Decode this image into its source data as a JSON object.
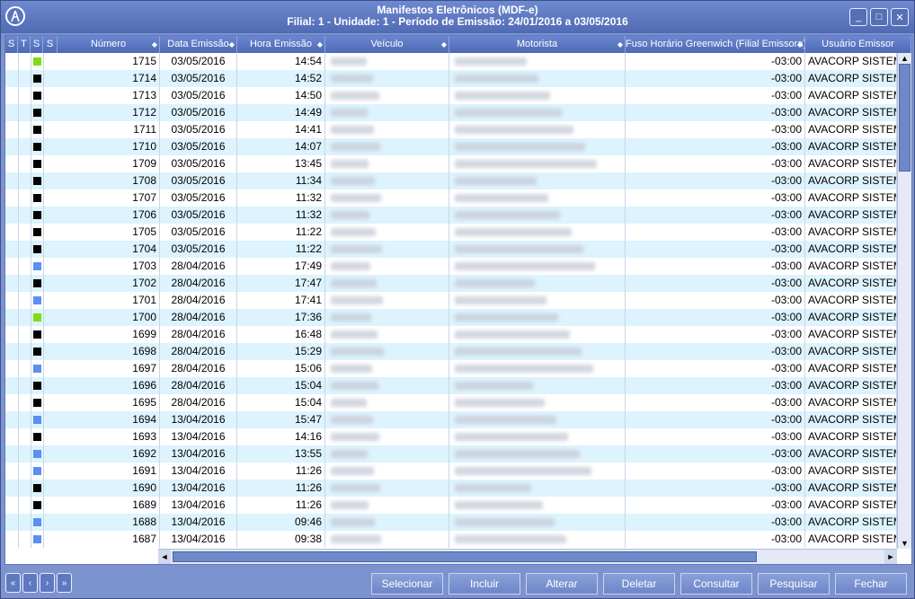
{
  "window": {
    "title_line1": "Manifestos Eletrônicos (MDF-e)",
    "title_line2": "Filial: 1 - Unidade: 1 - Período de Emissão: 24/01/2016 a 03/05/2016",
    "min_label": "_",
    "max_label": "□",
    "close_label": "✕"
  },
  "grid": {
    "headers": {
      "t": "S",
      "s1": "T",
      "s2": "S",
      "s3": "S",
      "numero": "Número",
      "data": "Data Emissão",
      "hora": "Hora Emissão",
      "veiculo": "Veículo",
      "motorista": "Motorista",
      "fuso": "Fuso Horário Greenwich (Filial Emissora)",
      "usuario": "Usuário Emissor"
    },
    "rows": [
      {
        "numero": "1715",
        "data": "03/05/2016",
        "hora": "14:54",
        "fuso": "-03:00",
        "usuario": "AVACORP SISTEMAS",
        "status_color": "#7fdc16"
      },
      {
        "numero": "1714",
        "data": "03/05/2016",
        "hora": "14:52",
        "fuso": "-03:00",
        "usuario": "AVACORP SISTEMAS",
        "status_color": "#000000"
      },
      {
        "numero": "1713",
        "data": "03/05/2016",
        "hora": "14:50",
        "fuso": "-03:00",
        "usuario": "AVACORP SISTEMAS",
        "status_color": "#000000"
      },
      {
        "numero": "1712",
        "data": "03/05/2016",
        "hora": "14:49",
        "fuso": "-03:00",
        "usuario": "AVACORP SISTEMAS",
        "status_color": "#000000"
      },
      {
        "numero": "1711",
        "data": "03/05/2016",
        "hora": "14:41",
        "fuso": "-03:00",
        "usuario": "AVACORP SISTEMAS",
        "status_color": "#000000"
      },
      {
        "numero": "1710",
        "data": "03/05/2016",
        "hora": "14:07",
        "fuso": "-03:00",
        "usuario": "AVACORP SISTEMAS",
        "status_color": "#000000"
      },
      {
        "numero": "1709",
        "data": "03/05/2016",
        "hora": "13:45",
        "fuso": "-03:00",
        "usuario": "AVACORP SISTEMAS",
        "status_color": "#000000"
      },
      {
        "numero": "1708",
        "data": "03/05/2016",
        "hora": "11:34",
        "fuso": "-03:00",
        "usuario": "AVACORP SISTEMAS",
        "status_color": "#000000"
      },
      {
        "numero": "1707",
        "data": "03/05/2016",
        "hora": "11:32",
        "fuso": "-03:00",
        "usuario": "AVACORP SISTEMAS",
        "status_color": "#000000"
      },
      {
        "numero": "1706",
        "data": "03/05/2016",
        "hora": "11:32",
        "fuso": "-03:00",
        "usuario": "AVACORP SISTEMAS",
        "status_color": "#000000"
      },
      {
        "numero": "1705",
        "data": "03/05/2016",
        "hora": "11:22",
        "fuso": "-03:00",
        "usuario": "AVACORP SISTEMAS",
        "status_color": "#000000"
      },
      {
        "numero": "1704",
        "data": "03/05/2016",
        "hora": "11:22",
        "fuso": "-03:00",
        "usuario": "AVACORP SISTEMAS",
        "status_color": "#000000"
      },
      {
        "numero": "1703",
        "data": "28/04/2016",
        "hora": "17:49",
        "fuso": "-03:00",
        "usuario": "AVACORP SISTEMAS",
        "status_color": "#5b8ff0"
      },
      {
        "numero": "1702",
        "data": "28/04/2016",
        "hora": "17:47",
        "fuso": "-03:00",
        "usuario": "AVACORP SISTEMAS",
        "status_color": "#000000"
      },
      {
        "numero": "1701",
        "data": "28/04/2016",
        "hora": "17:41",
        "fuso": "-03:00",
        "usuario": "AVACORP SISTEMAS",
        "status_color": "#5b8ff0"
      },
      {
        "numero": "1700",
        "data": "28/04/2016",
        "hora": "17:36",
        "fuso": "-03:00",
        "usuario": "AVACORP SISTEMAS",
        "status_color": "#7fdc16"
      },
      {
        "numero": "1699",
        "data": "28/04/2016",
        "hora": "16:48",
        "fuso": "-03:00",
        "usuario": "AVACORP SISTEMAS",
        "status_color": "#000000"
      },
      {
        "numero": "1698",
        "data": "28/04/2016",
        "hora": "15:29",
        "fuso": "-03:00",
        "usuario": "AVACORP SISTEMAS",
        "status_color": "#000000"
      },
      {
        "numero": "1697",
        "data": "28/04/2016",
        "hora": "15:06",
        "fuso": "-03:00",
        "usuario": "AVACORP SISTEMAS",
        "status_color": "#5b8ff0"
      },
      {
        "numero": "1696",
        "data": "28/04/2016",
        "hora": "15:04",
        "fuso": "-03:00",
        "usuario": "AVACORP SISTEMAS",
        "status_color": "#000000"
      },
      {
        "numero": "1695",
        "data": "28/04/2016",
        "hora": "15:04",
        "fuso": "-03:00",
        "usuario": "AVACORP SISTEMAS",
        "status_color": "#000000"
      },
      {
        "numero": "1694",
        "data": "13/04/2016",
        "hora": "15:47",
        "fuso": "-03:00",
        "usuario": "AVACORP SISTEMAS",
        "status_color": "#5b8ff0"
      },
      {
        "numero": "1693",
        "data": "13/04/2016",
        "hora": "14:16",
        "fuso": "-03:00",
        "usuario": "AVACORP SISTEMAS",
        "status_color": "#000000"
      },
      {
        "numero": "1692",
        "data": "13/04/2016",
        "hora": "13:55",
        "fuso": "-03:00",
        "usuario": "AVACORP SISTEMAS",
        "status_color": "#5b8ff0"
      },
      {
        "numero": "1691",
        "data": "13/04/2016",
        "hora": "11:26",
        "fuso": "-03:00",
        "usuario": "AVACORP SISTEMAS",
        "status_color": "#5b8ff0"
      },
      {
        "numero": "1690",
        "data": "13/04/2016",
        "hora": "11:26",
        "fuso": "-03:00",
        "usuario": "AVACORP SISTEMAS",
        "status_color": "#000000"
      },
      {
        "numero": "1689",
        "data": "13/04/2016",
        "hora": "11:26",
        "fuso": "-03:00",
        "usuario": "AVACORP SISTEMAS",
        "status_color": "#000000"
      },
      {
        "numero": "1688",
        "data": "13/04/2016",
        "hora": "09:46",
        "fuso": "-03:00",
        "usuario": "AVACORP SISTEMAS",
        "status_color": "#5b8ff0"
      },
      {
        "numero": "1687",
        "data": "13/04/2016",
        "hora": "09:38",
        "fuso": "-03:00",
        "usuario": "AVACORP SISTEMAS",
        "status_color": "#5b8ff0"
      }
    ]
  },
  "nav": {
    "first": "«",
    "prev": "‹",
    "next": "›",
    "last": "»"
  },
  "actions": {
    "selecionar": "Selecionar",
    "incluir": "Incluir",
    "alterar": "Alterar",
    "deletar": "Deletar",
    "consultar": "Consultar",
    "pesquisar": "Pesquisar",
    "fechar": "Fechar"
  },
  "colors": {
    "header_bg": "#5570b9",
    "row_alt": "#ddf3fd",
    "accent": "#6f86c4"
  }
}
